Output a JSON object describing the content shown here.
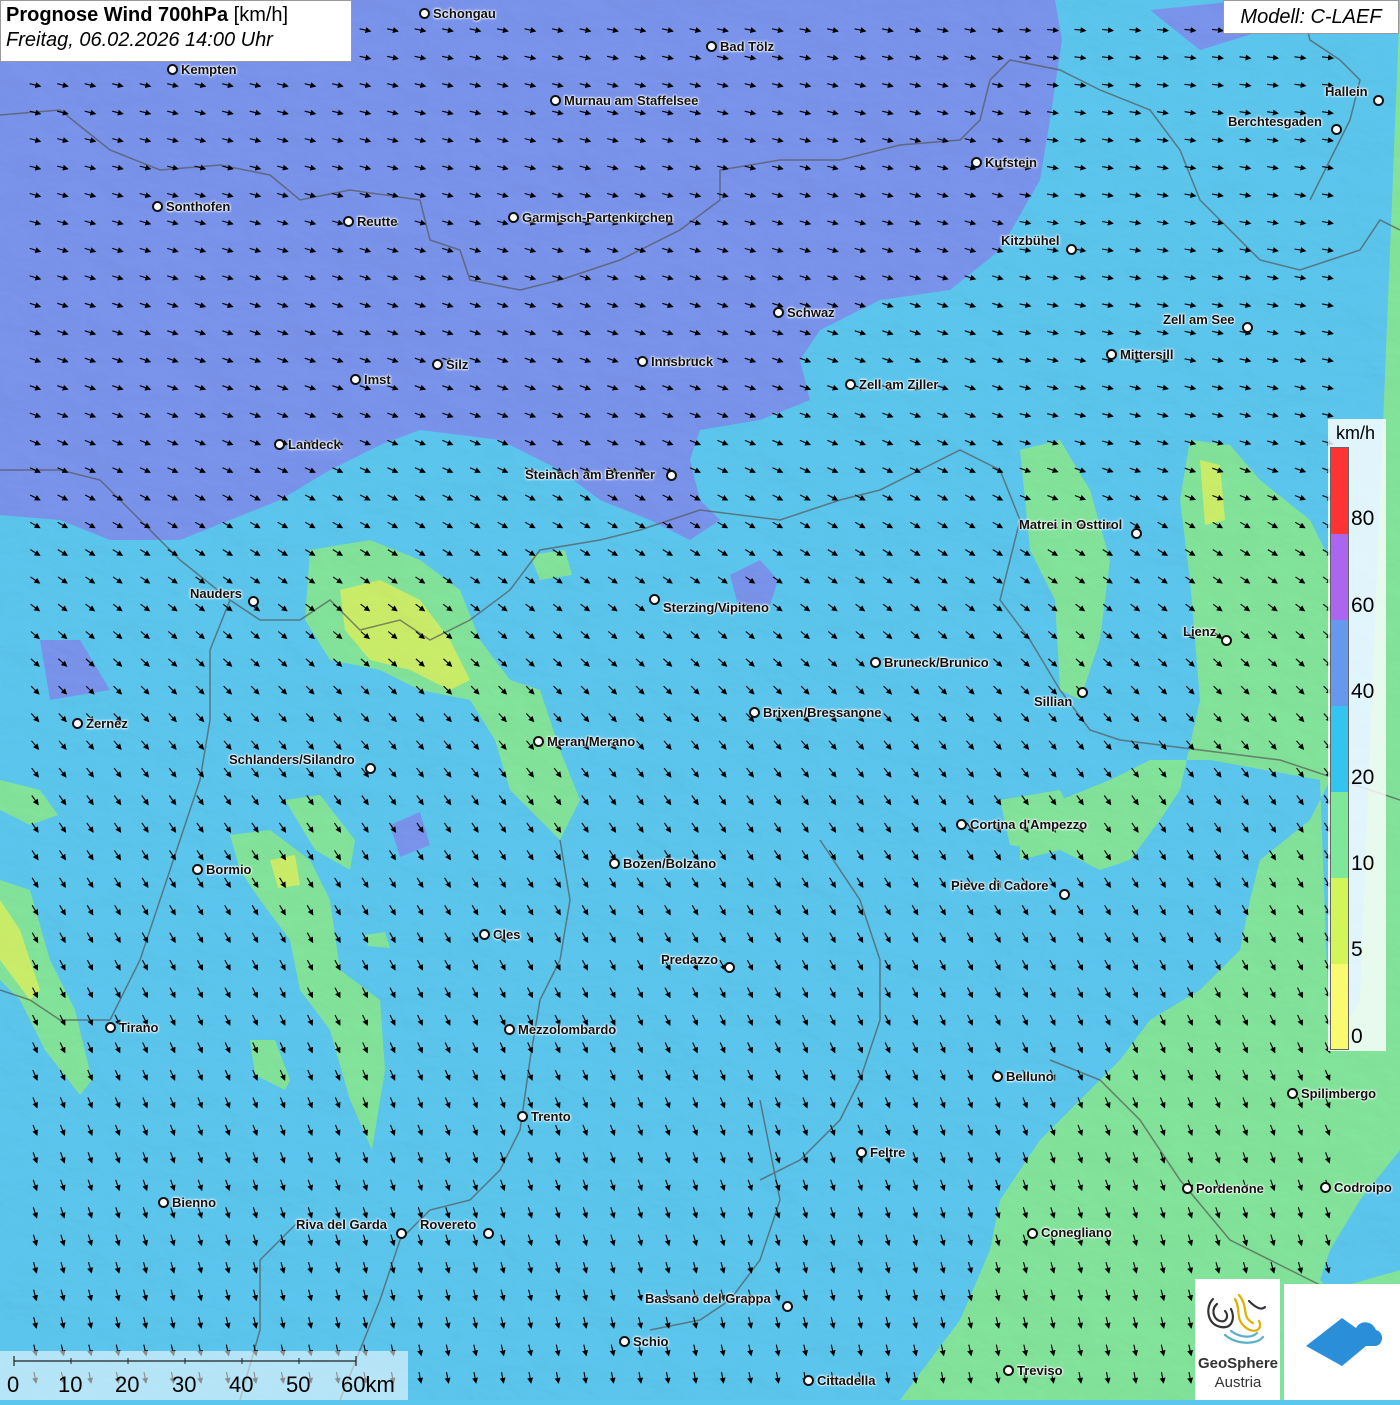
{
  "title": {
    "main": "Prognose Wind 700hPa",
    "unit": "[km/h]",
    "date": "Freitag, 06.02.2026 14:00 Uhr"
  },
  "model": "Modell: C-LAEF",
  "legend": {
    "unit": "km/h",
    "ticks": [
      "80",
      "60",
      "40",
      "20",
      "10",
      "5",
      "0"
    ],
    "colors": [
      "#ff3333",
      "#aa66ee",
      "#6699ee",
      "#33c4f0",
      "#7ee89a",
      "#d2f55a",
      "#fafa70"
    ]
  },
  "scale": {
    "labels": [
      "0",
      "10",
      "20",
      "30",
      "40",
      "50",
      "60km"
    ]
  },
  "logo": {
    "line1": "GeoSphere",
    "line2": "Austria"
  },
  "cities": [
    {
      "name": "Schongau",
      "dot": [
        424,
        13
      ],
      "lab": [
        433,
        6
      ]
    },
    {
      "name": "Bad Tölz",
      "dot": [
        711,
        46
      ],
      "lab": [
        720,
        39
      ]
    },
    {
      "name": "Kempten",
      "dot": [
        172,
        69
      ],
      "lab": [
        181,
        62
      ]
    },
    {
      "name": "Murnau am Staffelsee",
      "dot": [
        555,
        100
      ],
      "lab": [
        564,
        93
      ]
    },
    {
      "name": "Hallein",
      "dot": [
        1378,
        100
      ],
      "lab": [
        1325,
        84
      ]
    },
    {
      "name": "Berchtesgaden",
      "dot": [
        1336,
        129
      ],
      "lab": [
        1228,
        114
      ]
    },
    {
      "name": "Kufstein",
      "dot": [
        976,
        162
      ],
      "lab": [
        985,
        155
      ]
    },
    {
      "name": "Sonthofen",
      "dot": [
        157,
        206
      ],
      "lab": [
        166,
        199
      ]
    },
    {
      "name": "Reutte",
      "dot": [
        348,
        221
      ],
      "lab": [
        357,
        214
      ]
    },
    {
      "name": "Garmisch-Partenkirchen",
      "dot": [
        513,
        217
      ],
      "lab": [
        522,
        210
      ]
    },
    {
      "name": "Kitzbühel",
      "dot": [
        1071,
        249
      ],
      "lab": [
        1001,
        233
      ]
    },
    {
      "name": "Schwaz",
      "dot": [
        778,
        312
      ],
      "lab": [
        787,
        305
      ]
    },
    {
      "name": "Zell am See",
      "dot": [
        1247,
        327
      ],
      "lab": [
        1163,
        312
      ]
    },
    {
      "name": "Mittersill",
      "dot": [
        1111,
        354
      ],
      "lab": [
        1120,
        347
      ]
    },
    {
      "name": "Innsbruck",
      "dot": [
        642,
        361
      ],
      "lab": [
        651,
        354
      ]
    },
    {
      "name": "Silz",
      "dot": [
        437,
        364
      ],
      "lab": [
        446,
        357
      ]
    },
    {
      "name": "Imst",
      "dot": [
        355,
        379
      ],
      "lab": [
        364,
        372
      ]
    },
    {
      "name": "Zell am Ziller",
      "dot": [
        850,
        384
      ],
      "lab": [
        859,
        377
      ]
    },
    {
      "name": "Landeck",
      "dot": [
        279,
        444
      ],
      "lab": [
        288,
        437
      ]
    },
    {
      "name": "Steinach am Brenner",
      "dot": [
        671,
        475
      ],
      "lab": [
        525,
        467
      ]
    },
    {
      "name": "Matrei in Osttirol",
      "dot": [
        1136,
        533
      ],
      "lab": [
        1019,
        517
      ]
    },
    {
      "name": "Nauders",
      "dot": [
        253,
        601
      ],
      "lab": [
        190,
        586
      ]
    },
    {
      "name": "Sterzing/Vipiteno",
      "dot": [
        654,
        599
      ],
      "lab": [
        663,
        600
      ]
    },
    {
      "name": "Lienz",
      "dot": [
        1226,
        640
      ],
      "lab": [
        1183,
        624
      ]
    },
    {
      "name": "Bruneck/Brunico",
      "dot": [
        875,
        662
      ],
      "lab": [
        884,
        655
      ]
    },
    {
      "name": "Sillian",
      "dot": [
        1082,
        692
      ],
      "lab": [
        1034,
        694
      ]
    },
    {
      "name": "Brixen/Bressanone",
      "dot": [
        754,
        712
      ],
      "lab": [
        763,
        705
      ]
    },
    {
      "name": "Zernez",
      "dot": [
        77,
        723
      ],
      "lab": [
        86,
        716
      ]
    },
    {
      "name": "Meran/Merano",
      "dot": [
        538,
        741
      ],
      "lab": [
        547,
        734
      ]
    },
    {
      "name": "Schlanders/Silandro",
      "dot": [
        370,
        768
      ],
      "lab": [
        229,
        752
      ]
    },
    {
      "name": "Cortina d'Ampezzo",
      "dot": [
        961,
        824
      ],
      "lab": [
        970,
        817
      ]
    },
    {
      "name": "Bozen/Bolzano",
      "dot": [
        614,
        863
      ],
      "lab": [
        623,
        856
      ]
    },
    {
      "name": "Bormio",
      "dot": [
        197,
        869
      ],
      "lab": [
        206,
        862
      ]
    },
    {
      "name": "Pieve di Cadore",
      "dot": [
        1064,
        894
      ],
      "lab": [
        951,
        878
      ]
    },
    {
      "name": "Cles",
      "dot": [
        484,
        934
      ],
      "lab": [
        493,
        927
      ]
    },
    {
      "name": "Predazzo",
      "dot": [
        729,
        967
      ],
      "lab": [
        661,
        952
      ]
    },
    {
      "name": "Tirano",
      "dot": [
        110,
        1027
      ],
      "lab": [
        119,
        1020
      ]
    },
    {
      "name": "Mezzolombardo",
      "dot": [
        509,
        1029
      ],
      "lab": [
        518,
        1022
      ]
    },
    {
      "name": "Belluno",
      "dot": [
        997,
        1076
      ],
      "lab": [
        1006,
        1069
      ]
    },
    {
      "name": "Spilimbergo",
      "dot": [
        1292,
        1093
      ],
      "lab": [
        1301,
        1086
      ]
    },
    {
      "name": "Trento",
      "dot": [
        522,
        1116
      ],
      "lab": [
        531,
        1109
      ]
    },
    {
      "name": "Feltre",
      "dot": [
        861,
        1152
      ],
      "lab": [
        870,
        1145
      ]
    },
    {
      "name": "Pordenone",
      "dot": [
        1187,
        1188
      ],
      "lab": [
        1196,
        1181
      ]
    },
    {
      "name": "Codroipo",
      "dot": [
        1325,
        1187
      ],
      "lab": [
        1334,
        1180
      ]
    },
    {
      "name": "Bienno",
      "dot": [
        163,
        1202
      ],
      "lab": [
        172,
        1195
      ]
    },
    {
      "name": "Riva del Garda",
      "dot": [
        401,
        1233
      ],
      "lab": [
        296,
        1217
      ]
    },
    {
      "name": "Rovereto",
      "dot": [
        488,
        1233
      ],
      "lab": [
        420,
        1217
      ]
    },
    {
      "name": "Conegliano",
      "dot": [
        1032,
        1233
      ],
      "lab": [
        1041,
        1225
      ]
    },
    {
      "name": "Bassano del Grappa",
      "dot": [
        787,
        1306
      ],
      "lab": [
        645,
        1291
      ]
    },
    {
      "name": "Schio",
      "dot": [
        624,
        1341
      ],
      "lab": [
        633,
        1334
      ]
    },
    {
      "name": "Treviso",
      "dot": [
        1008,
        1370
      ],
      "lab": [
        1017,
        1363
      ]
    },
    {
      "name": "Cittadella",
      "dot": [
        808,
        1380
      ],
      "lab": [
        817,
        1373
      ]
    }
  ]
}
